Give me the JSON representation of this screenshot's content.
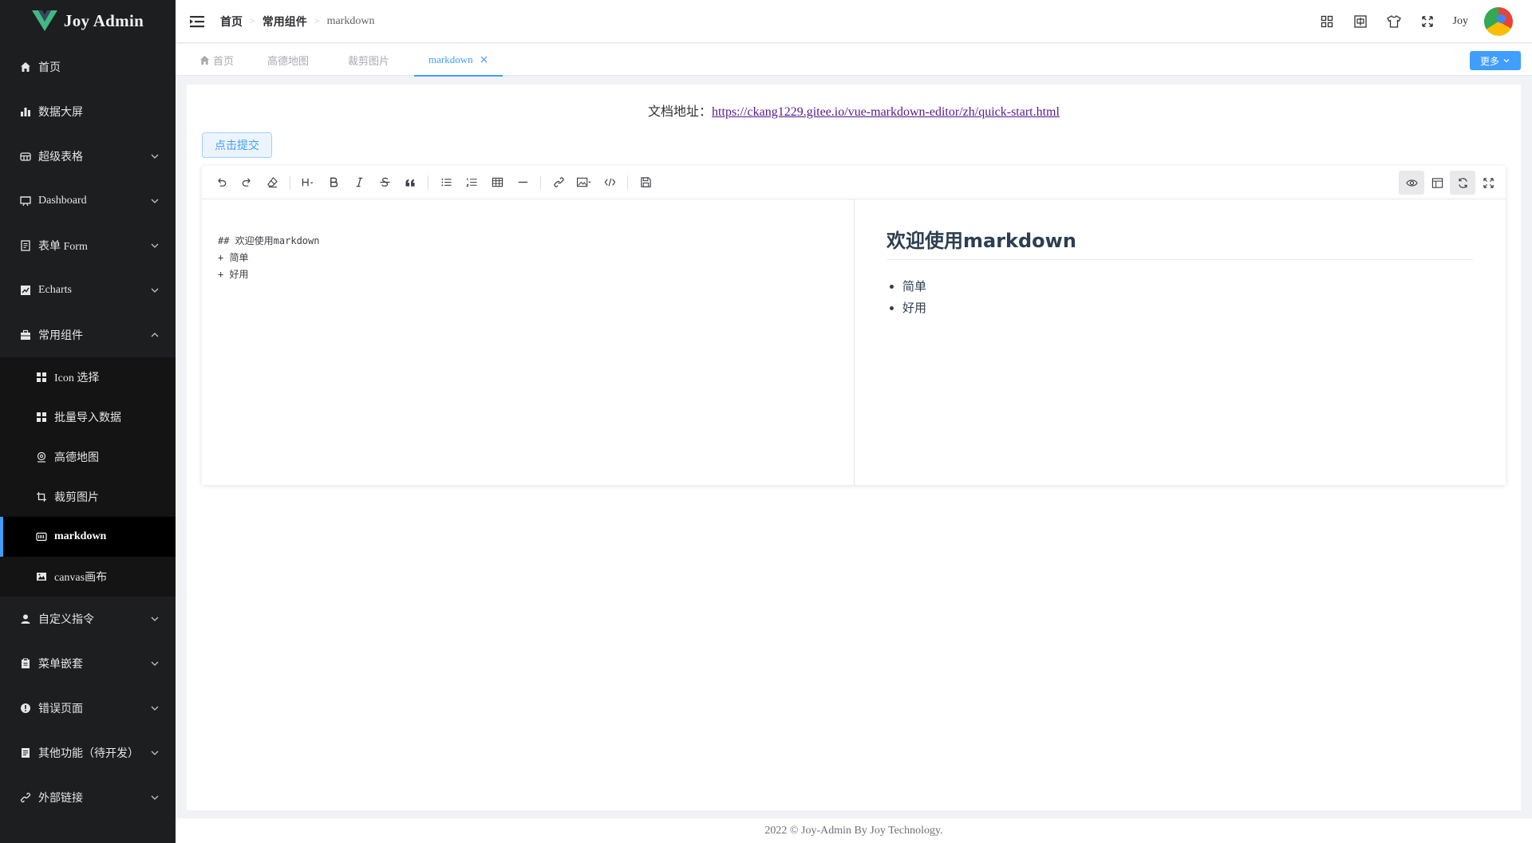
{
  "app": {
    "title": "Joy Admin",
    "accent_color": "#409eff"
  },
  "sidebar": {
    "items": [
      {
        "label": "首页",
        "icon": "home-icon"
      },
      {
        "label": "数据大屏",
        "icon": "bar-chart-icon"
      },
      {
        "label": "超级表格",
        "icon": "table-icon",
        "expandable": true
      },
      {
        "label": "Dashboard",
        "icon": "monitor-icon",
        "expandable": true
      },
      {
        "label": "表单 Form",
        "icon": "form-icon",
        "expandable": true
      },
      {
        "label": "Echarts",
        "icon": "chart-icon",
        "expandable": true
      },
      {
        "label": "常用组件",
        "icon": "briefcase-icon",
        "expanded": true
      }
    ],
    "submenu": [
      {
        "label": "Icon 选择",
        "icon": "grid-icon"
      },
      {
        "label": "批量导入数据",
        "icon": "grid-icon"
      },
      {
        "label": "高德地图",
        "icon": "location-icon"
      },
      {
        "label": "裁剪图片",
        "icon": "crop-icon"
      },
      {
        "label": "markdown",
        "icon": "keyboard-icon",
        "active": true
      },
      {
        "label": "canvas画布",
        "icon": "picture-icon"
      }
    ],
    "items_after": [
      {
        "label": "自定义指令",
        "icon": "user-icon"
      },
      {
        "label": "菜单嵌套",
        "icon": "clipboard-icon"
      },
      {
        "label": "错误页面",
        "icon": "warning-icon"
      },
      {
        "label": "其他功能（待开发）",
        "icon": "document-icon"
      },
      {
        "label": "外部链接",
        "icon": "link-icon"
      }
    ]
  },
  "header": {
    "breadcrumb": [
      "首页",
      "常用组件",
      "markdown"
    ],
    "username": "Joy"
  },
  "tabs": {
    "items": [
      "首页",
      "高德地图",
      "裁剪图片",
      "markdown"
    ],
    "active": "markdown",
    "more_label": "更多"
  },
  "main": {
    "doc_label": "文档地址：",
    "doc_url": "https://ckang1229.gitee.io/vue-markdown-editor/zh/quick-start.html",
    "submit_label": "点击提交",
    "source_lines": [
      "## 欢迎使用markdown",
      "+ 简单",
      "+ 好用"
    ],
    "preview": {
      "heading": "欢迎使用markdown",
      "list": [
        "简单",
        "好用"
      ]
    }
  },
  "footer": {
    "text": "2022 © Joy-Admin By Joy Technology."
  }
}
